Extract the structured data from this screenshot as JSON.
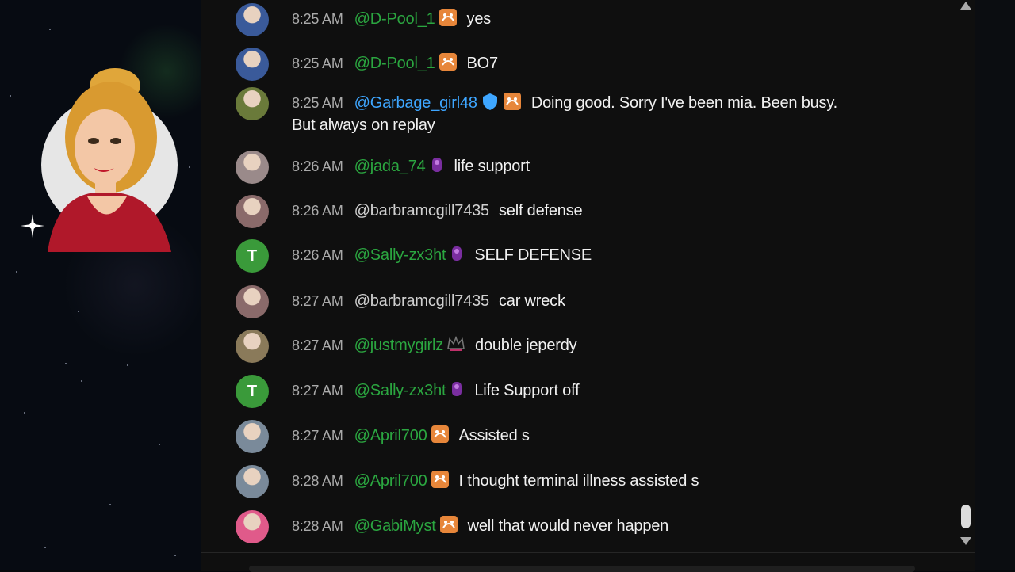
{
  "messages": [
    {
      "time": "8:25 AM",
      "author": "@D-Pool_1",
      "author_style": "member",
      "badges": [
        "wat-the-badge"
      ],
      "text": "yes",
      "avatar": "photo",
      "avatar_color": "#3a5a9a"
    },
    {
      "time": "8:25 AM",
      "author": "@D-Pool_1",
      "author_style": "member",
      "badges": [
        "wat-the-badge"
      ],
      "text": "BO7",
      "avatar": "photo",
      "avatar_color": "#3a5a9a"
    },
    {
      "time": "8:25 AM",
      "author": "@Garbage_girl48",
      "author_style": "moderator",
      "badges": [
        "shield-badge",
        "wat-the-badge"
      ],
      "text": "Doing good. Sorry I've been mia. Been busy.",
      "text2": "But always on replay",
      "avatar": "photo",
      "avatar_color": "#6a7a3a"
    },
    {
      "time": "8:26 AM",
      "author": "@jada_74",
      "author_style": "member",
      "badges": [
        "purple-member-badge"
      ],
      "text": "life support",
      "avatar": "photo",
      "avatar_color": "#9a8a8a"
    },
    {
      "time": "8:26 AM",
      "author": "@barbramcgill7435",
      "author_style": "plain",
      "badges": [],
      "text": "self defense",
      "avatar": "photo",
      "avatar_color": "#8a6a6a"
    },
    {
      "time": "8:26 AM",
      "author": "@Sally-zx3ht",
      "author_style": "member",
      "badges": [
        "purple-member-badge"
      ],
      "text": "SELF DEFENSE",
      "avatar": "letter",
      "avatar_letter": "T",
      "avatar_color": "#3a9a3a"
    },
    {
      "time": "8:27 AM",
      "author": "@barbramcgill7435",
      "author_style": "plain",
      "badges": [],
      "text": "car wreck",
      "avatar": "photo",
      "avatar_color": "#8a6a6a"
    },
    {
      "time": "8:27 AM",
      "author": "@justmygirlz",
      "author_style": "member",
      "badges": [
        "crown-badge"
      ],
      "text": "double jeperdy",
      "avatar": "photo",
      "avatar_color": "#8a7a5a"
    },
    {
      "time": "8:27 AM",
      "author": "@Sally-zx3ht",
      "author_style": "member",
      "badges": [
        "purple-member-badge"
      ],
      "text": "Life Support off",
      "avatar": "letter",
      "avatar_letter": "T",
      "avatar_color": "#3a9a3a"
    },
    {
      "time": "8:27 AM",
      "author": "@April700",
      "author_style": "member",
      "badges": [
        "wat-the-badge"
      ],
      "text": "Assisted s",
      "avatar": "photo",
      "avatar_color": "#7a8a9a"
    },
    {
      "time": "8:28 AM",
      "author": "@April700",
      "author_style": "member",
      "badges": [
        "wat-the-badge"
      ],
      "text": "I thought terminal illness assisted s",
      "avatar": "photo",
      "avatar_color": "#7a8a9a"
    },
    {
      "time": "8:28 AM",
      "author": "@GabiMyst",
      "author_style": "member",
      "badges": [
        "wat-the-badge"
      ],
      "text": "well that would never happen",
      "avatar": "photo",
      "avatar_color": "#e05a8a"
    }
  ],
  "colors": {
    "member_name": "#2ba640",
    "moderator_name": "#3ea6ff",
    "timestamp": "#aaaaaa",
    "chat_background": "#0f0f0f"
  },
  "icons": {
    "scroll_up": "triangle-up-icon",
    "scroll_down": "triangle-down-icon"
  }
}
